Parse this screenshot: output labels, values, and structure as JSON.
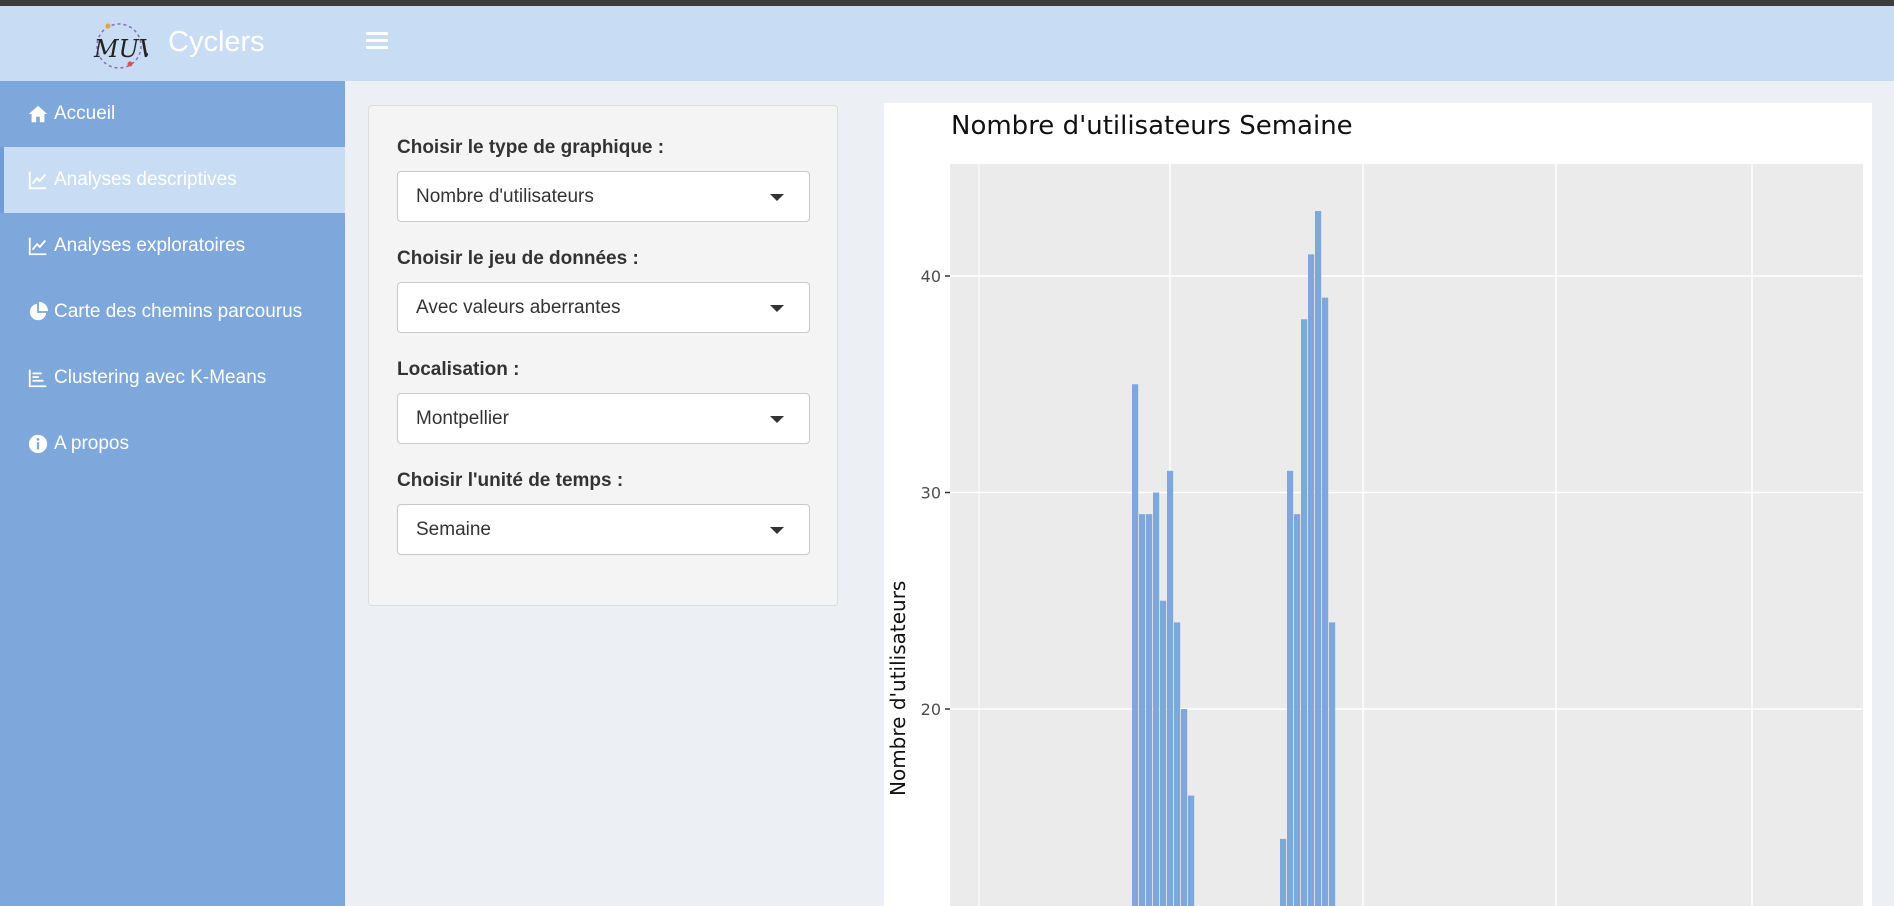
{
  "header": {
    "title": "Cyclers",
    "logo_text": "MUV",
    "menu_icon": "hamburger-icon"
  },
  "sidebar": {
    "items": [
      {
        "label": "Accueil",
        "icon": "home-icon",
        "active": false
      },
      {
        "label": "Analyses descriptives",
        "icon": "line-chart-icon",
        "active": true
      },
      {
        "label": "Analyses exploratoires",
        "icon": "line-chart-icon",
        "active": false
      },
      {
        "label": "Carte des chemins parcourus",
        "icon": "pie-chart-icon",
        "active": false
      },
      {
        "label": "Clustering avec K-Means",
        "icon": "bar-chart-icon",
        "active": false
      },
      {
        "label": "A propos",
        "icon": "info-icon",
        "active": false
      }
    ]
  },
  "filters": {
    "chart_type": {
      "label": "Choisir le type de graphique :",
      "value": "Nombre d'utilisateurs"
    },
    "dataset": {
      "label": "Choisir le jeu de données :",
      "value": "Avec valeurs aberrantes"
    },
    "location": {
      "label": "Localisation :",
      "value": "Montpellier"
    },
    "time_unit": {
      "label": "Choisir l'unité de temps :",
      "value": "Semaine"
    }
  },
  "colors": {
    "header_bg": "#c8ddf4",
    "sidebar_bg": "#7ea7db",
    "bar_fill": "#7ea7db",
    "plot_panel": "#ebebeb"
  },
  "chart_data": {
    "type": "bar",
    "title": "Nombre d'utilisateurs Semaine",
    "xlabel": "",
    "ylabel": "Nombre d'utilisateurs",
    "y_ticks": [
      20,
      30,
      40
    ],
    "ylim": [
      14,
      45
    ],
    "grid": true,
    "series": [
      {
        "values": [
          35,
          29,
          29,
          30,
          25,
          31,
          24,
          20,
          16,
          14,
          31,
          29,
          38,
          41,
          43,
          39,
          24
        ]
      }
    ]
  }
}
